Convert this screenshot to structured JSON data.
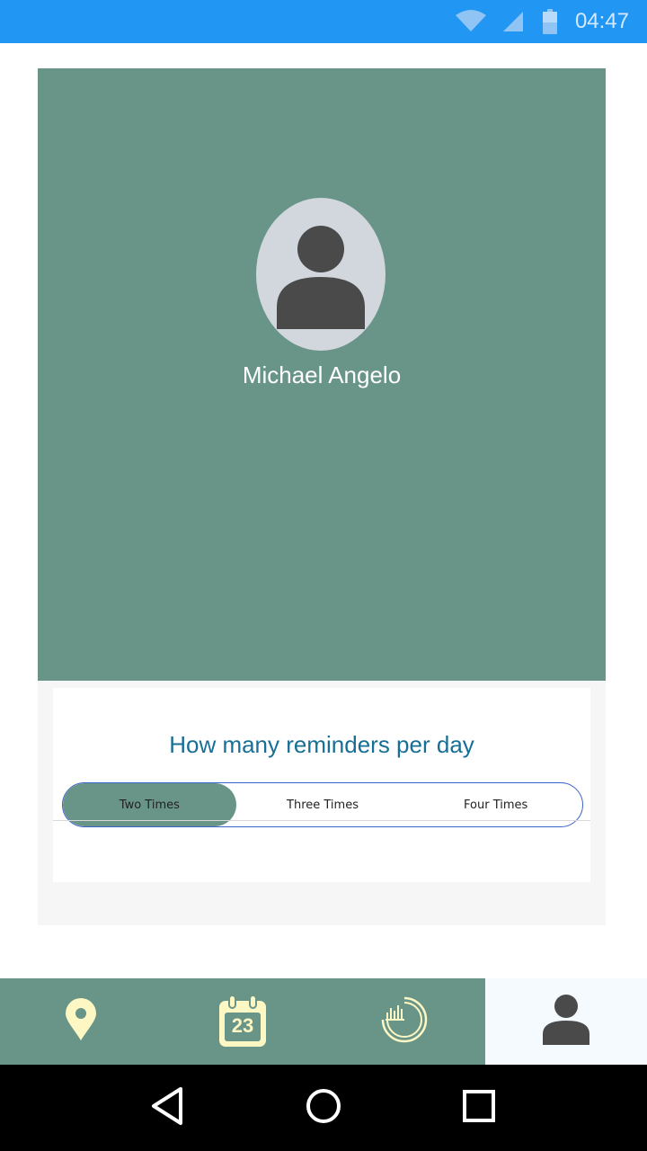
{
  "status_bar": {
    "time": "04:47",
    "icons": [
      "wifi-icon",
      "signal-icon",
      "battery-icon"
    ],
    "color": "#2196f3"
  },
  "profile": {
    "name": "Michael Angelo",
    "card_color": "#699488",
    "avatar_icon": "user-avatar-icon"
  },
  "reminders": {
    "title": "How many reminders per day",
    "options": [
      "Two Times",
      "Three Times",
      "Four Times"
    ],
    "selected": "Two Times"
  },
  "bottom_nav": {
    "items": [
      {
        "icon": "location-pin-icon"
      },
      {
        "icon": "calendar-icon",
        "badge": "23"
      },
      {
        "icon": "statistics-chart-icon"
      },
      {
        "icon": "profile-icon",
        "active": true
      }
    ]
  },
  "system_nav": {
    "buttons": [
      "back-icon",
      "home-icon",
      "recents-icon"
    ]
  }
}
